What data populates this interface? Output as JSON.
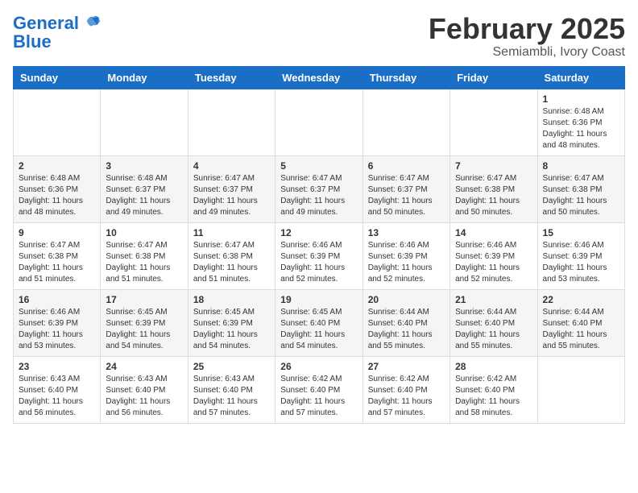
{
  "header": {
    "logo_line1": "General",
    "logo_line2": "Blue",
    "month": "February 2025",
    "location": "Semiambli, Ivory Coast"
  },
  "weekdays": [
    "Sunday",
    "Monday",
    "Tuesday",
    "Wednesday",
    "Thursday",
    "Friday",
    "Saturday"
  ],
  "weeks": [
    [
      {
        "day": "",
        "info": ""
      },
      {
        "day": "",
        "info": ""
      },
      {
        "day": "",
        "info": ""
      },
      {
        "day": "",
        "info": ""
      },
      {
        "day": "",
        "info": ""
      },
      {
        "day": "",
        "info": ""
      },
      {
        "day": "1",
        "info": "Sunrise: 6:48 AM\nSunset: 6:36 PM\nDaylight: 11 hours and 48 minutes."
      }
    ],
    [
      {
        "day": "2",
        "info": "Sunrise: 6:48 AM\nSunset: 6:36 PM\nDaylight: 11 hours and 48 minutes."
      },
      {
        "day": "3",
        "info": "Sunrise: 6:48 AM\nSunset: 6:37 PM\nDaylight: 11 hours and 49 minutes."
      },
      {
        "day": "4",
        "info": "Sunrise: 6:47 AM\nSunset: 6:37 PM\nDaylight: 11 hours and 49 minutes."
      },
      {
        "day": "5",
        "info": "Sunrise: 6:47 AM\nSunset: 6:37 PM\nDaylight: 11 hours and 49 minutes."
      },
      {
        "day": "6",
        "info": "Sunrise: 6:47 AM\nSunset: 6:37 PM\nDaylight: 11 hours and 50 minutes."
      },
      {
        "day": "7",
        "info": "Sunrise: 6:47 AM\nSunset: 6:38 PM\nDaylight: 11 hours and 50 minutes."
      },
      {
        "day": "8",
        "info": "Sunrise: 6:47 AM\nSunset: 6:38 PM\nDaylight: 11 hours and 50 minutes."
      }
    ],
    [
      {
        "day": "9",
        "info": "Sunrise: 6:47 AM\nSunset: 6:38 PM\nDaylight: 11 hours and 51 minutes."
      },
      {
        "day": "10",
        "info": "Sunrise: 6:47 AM\nSunset: 6:38 PM\nDaylight: 11 hours and 51 minutes."
      },
      {
        "day": "11",
        "info": "Sunrise: 6:47 AM\nSunset: 6:38 PM\nDaylight: 11 hours and 51 minutes."
      },
      {
        "day": "12",
        "info": "Sunrise: 6:46 AM\nSunset: 6:39 PM\nDaylight: 11 hours and 52 minutes."
      },
      {
        "day": "13",
        "info": "Sunrise: 6:46 AM\nSunset: 6:39 PM\nDaylight: 11 hours and 52 minutes."
      },
      {
        "day": "14",
        "info": "Sunrise: 6:46 AM\nSunset: 6:39 PM\nDaylight: 11 hours and 52 minutes."
      },
      {
        "day": "15",
        "info": "Sunrise: 6:46 AM\nSunset: 6:39 PM\nDaylight: 11 hours and 53 minutes."
      }
    ],
    [
      {
        "day": "16",
        "info": "Sunrise: 6:46 AM\nSunset: 6:39 PM\nDaylight: 11 hours and 53 minutes."
      },
      {
        "day": "17",
        "info": "Sunrise: 6:45 AM\nSunset: 6:39 PM\nDaylight: 11 hours and 54 minutes."
      },
      {
        "day": "18",
        "info": "Sunrise: 6:45 AM\nSunset: 6:39 PM\nDaylight: 11 hours and 54 minutes."
      },
      {
        "day": "19",
        "info": "Sunrise: 6:45 AM\nSunset: 6:40 PM\nDaylight: 11 hours and 54 minutes."
      },
      {
        "day": "20",
        "info": "Sunrise: 6:44 AM\nSunset: 6:40 PM\nDaylight: 11 hours and 55 minutes."
      },
      {
        "day": "21",
        "info": "Sunrise: 6:44 AM\nSunset: 6:40 PM\nDaylight: 11 hours and 55 minutes."
      },
      {
        "day": "22",
        "info": "Sunrise: 6:44 AM\nSunset: 6:40 PM\nDaylight: 11 hours and 55 minutes."
      }
    ],
    [
      {
        "day": "23",
        "info": "Sunrise: 6:43 AM\nSunset: 6:40 PM\nDaylight: 11 hours and 56 minutes."
      },
      {
        "day": "24",
        "info": "Sunrise: 6:43 AM\nSunset: 6:40 PM\nDaylight: 11 hours and 56 minutes."
      },
      {
        "day": "25",
        "info": "Sunrise: 6:43 AM\nSunset: 6:40 PM\nDaylight: 11 hours and 57 minutes."
      },
      {
        "day": "26",
        "info": "Sunrise: 6:42 AM\nSunset: 6:40 PM\nDaylight: 11 hours and 57 minutes."
      },
      {
        "day": "27",
        "info": "Sunrise: 6:42 AM\nSunset: 6:40 PM\nDaylight: 11 hours and 57 minutes."
      },
      {
        "day": "28",
        "info": "Sunrise: 6:42 AM\nSunset: 6:40 PM\nDaylight: 11 hours and 58 minutes."
      },
      {
        "day": "",
        "info": ""
      }
    ]
  ]
}
